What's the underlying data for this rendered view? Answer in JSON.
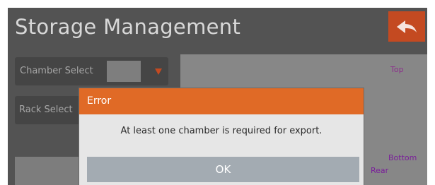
{
  "app": {
    "title": "Storage Management"
  },
  "controls": {
    "chamber_select_label": "Chamber Select",
    "rack_select_label": "Rack Select"
  },
  "chamber_view": {
    "top_label": "Top",
    "bottom_label": "Bottom",
    "rear_label": "Rear"
  },
  "dialog": {
    "title": "Error",
    "message": "At least one chamber is required for export.",
    "ok_label": "OK"
  },
  "icons": {
    "back": "back-arrow-icon",
    "dropdown": "triangle-down-icon"
  },
  "colors": {
    "background": "#535353",
    "accent": "#c44a21",
    "dialog_header": "#e06a26",
    "view_labels": "#7a1f9a"
  }
}
